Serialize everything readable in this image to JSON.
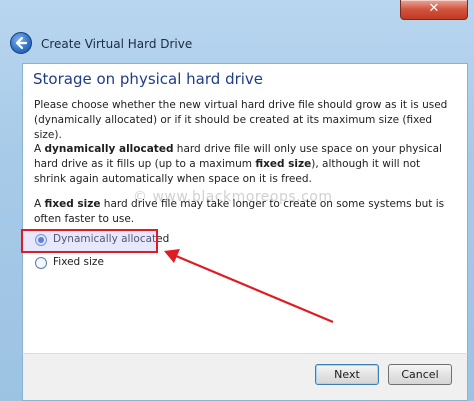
{
  "window": {
    "title": "Create Virtual Hard Drive",
    "close_label": "✕"
  },
  "page": {
    "heading": "Storage on physical hard drive",
    "intro": "Please choose whether the new virtual hard drive file should grow as it is used (dynamically allocated) or if it should be created at its maximum size (fixed size).",
    "dynamic_desc": {
      "a": "A ",
      "b": "dynamically allocated",
      "c": " hard drive file will only use space on your physical hard drive as it fills up (up to a maximum ",
      "d": "fixed size",
      "e": "), although it will not shrink again automatically when space on it is freed."
    },
    "fixed_desc": {
      "a": "A ",
      "b": "fixed size",
      "c": " hard drive file may take longer to create on some systems but is often faster to use."
    },
    "watermark": "© www.blackmoreops.com"
  },
  "options": {
    "dynamic": {
      "label": "Dynamically allocated",
      "selected": true
    },
    "fixed": {
      "label": "Fixed size",
      "selected": false
    }
  },
  "buttons": {
    "next": "Next",
    "cancel": "Cancel"
  },
  "colors": {
    "annotation_red": "#e01b22",
    "heading_blue": "#1f3c8c"
  }
}
